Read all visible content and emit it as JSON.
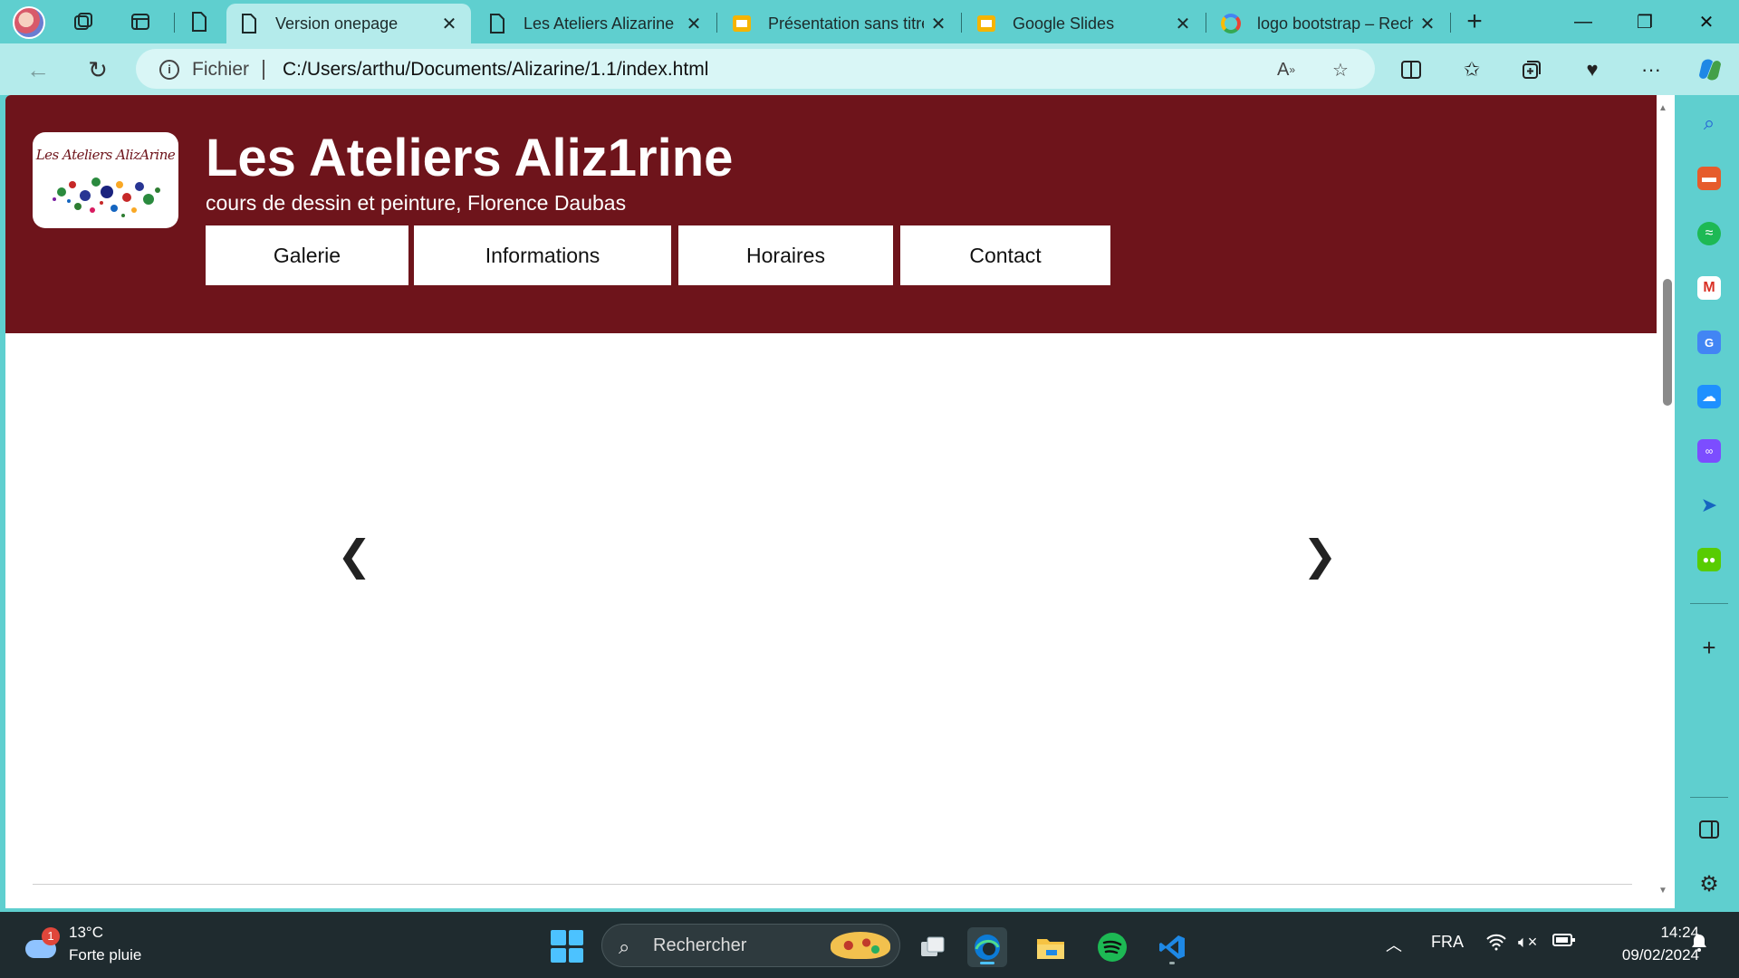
{
  "browser": {
    "tabs": [
      {
        "label": "Version onepage",
        "active": true
      },
      {
        "label": "Les Ateliers Alizarine",
        "active": false
      },
      {
        "label": "Présentation sans titre",
        "active": false
      },
      {
        "label": "Google Slides",
        "active": false
      },
      {
        "label": "logo bootstrap – Recherche",
        "active": false
      }
    ],
    "address": {
      "scheme_label": "Fichier",
      "url": "C:/Users/arthu/Documents/Alizarine/1.1/index.html"
    }
  },
  "page": {
    "logo_text": "Les Ateliers AlizArine",
    "title": "Les Ateliers Aliz1rine",
    "subtitle": "cours de dessin et peinture, Florence Daubas",
    "menu": [
      "Galerie",
      "Informations",
      "Horaires",
      "Contact"
    ],
    "carousel": {
      "prev": "❮",
      "next": "❯"
    }
  },
  "taskbar": {
    "weather": {
      "temp": "13°C",
      "desc": "Forte pluie",
      "badge": "1"
    },
    "search_placeholder": "Rechercher",
    "language": "FRA",
    "time": "14:24",
    "date": "09/02/2024"
  },
  "colors": {
    "header_bg": "#6e141b",
    "browser_accent": "#5fcfcf"
  }
}
